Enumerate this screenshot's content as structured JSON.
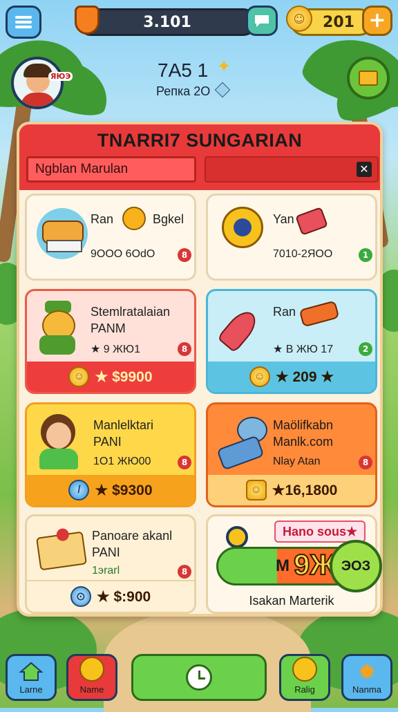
{
  "top_bar": {
    "currency_1": "3.101",
    "currency_2": "201",
    "plus_label": "+"
  },
  "player": {
    "avatar_tag": "ЯЮЭ",
    "score": "7А5 1",
    "rank_label": "Репка 2О"
  },
  "panel": {
    "title": "TNARRI7 SUNGARIAN",
    "search_value": "Ngblan Marulan",
    "close_label": "✕"
  },
  "cards": [
    {
      "name": "Ran",
      "name2": "Bgkel",
      "code": "9OOO 6OdO",
      "badge": "8",
      "price": ""
    },
    {
      "name": "Yan",
      "code": "7010-2ЯOO",
      "badge": "1",
      "price": ""
    },
    {
      "name": "Stemlratalaian",
      "sub": "РАNМ",
      "stats": "★ 9 ЖЮ1",
      "badge": "8",
      "price": "★ $9900"
    },
    {
      "name": "Ran",
      "stats": "★ B ЖЮ 17",
      "badge": "2",
      "price": "★ 209 ★"
    },
    {
      "name": "Manlelktari",
      "sub": "РАNI",
      "stats": "1O1 ЖЮ00",
      "badge": "8",
      "price": "★ $9300"
    },
    {
      "name": "Maölifkabn",
      "sub": "Manlk.com",
      "stats": "Nlay Atan",
      "badge": "8",
      "price": "★16,1800"
    },
    {
      "name": "Panoare akanl",
      "sub": "РАNI",
      "stats": "1эrarl",
      "badge": "8",
      "price": "★ $:900"
    },
    {
      "tag": "Hano sous★",
      "amount": "9Ж",
      "amount_prefix": "M",
      "bubble": "ЭОЗ",
      "footer": "Isakan Marterik"
    }
  ],
  "bottom_nav": [
    {
      "label": "Larne"
    },
    {
      "label": "Name"
    },
    {
      "label": ""
    },
    {
      "label": "Ralig"
    },
    {
      "label": "Nanma"
    }
  ],
  "colors": {
    "header_red": "#e83a3a",
    "card_pink": "#ffd9d0",
    "card_blue": "#c9eef7",
    "card_yellow": "#ffd84a",
    "card_orange": "#ff8a3a",
    "play_green": "#6bd14b"
  }
}
